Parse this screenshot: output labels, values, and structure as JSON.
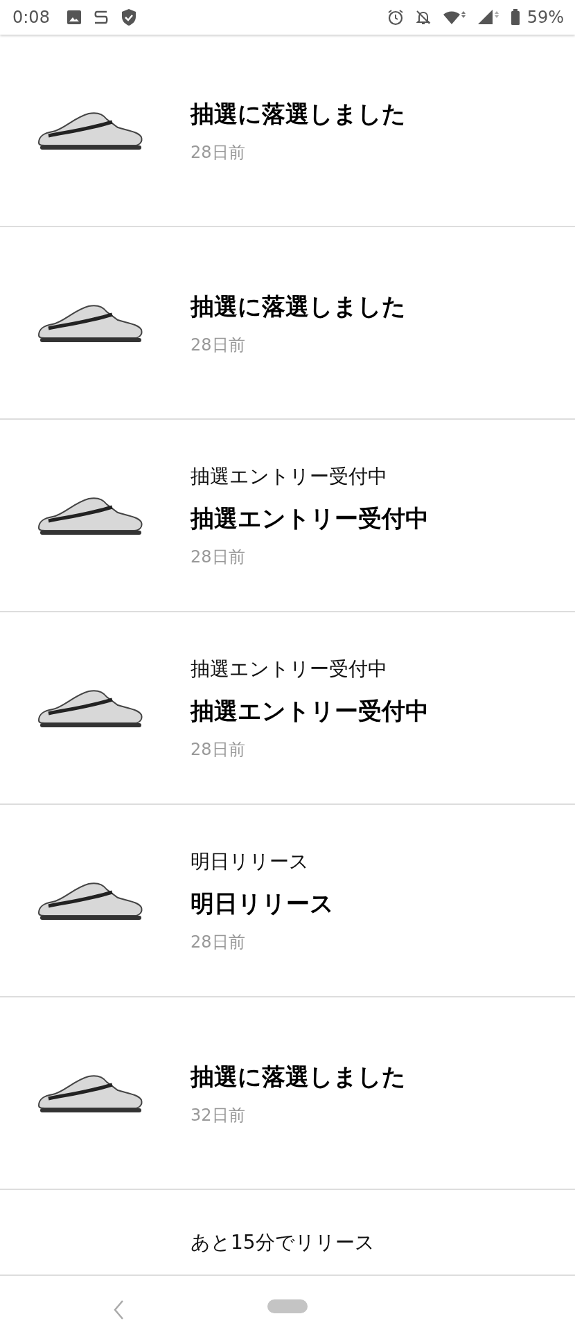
{
  "status_bar": {
    "time": "0:08",
    "battery": "59%"
  },
  "notifications": [
    {
      "title": "抽選に落選しました",
      "time": "28日前"
    },
    {
      "title": "抽選に落選しました",
      "time": "28日前"
    },
    {
      "subtitle": "抽選エントリー受付中",
      "title": "抽選エントリー受付中",
      "time": "28日前"
    },
    {
      "subtitle": "抽選エントリー受付中",
      "title": "抽選エントリー受付中",
      "time": "28日前"
    },
    {
      "subtitle": "明日リリース",
      "title": "明日リリース",
      "time": "28日前"
    },
    {
      "title": "抽選に落選しました",
      "time": "32日前"
    },
    {
      "subtitle": "あと15分でリリース"
    }
  ]
}
